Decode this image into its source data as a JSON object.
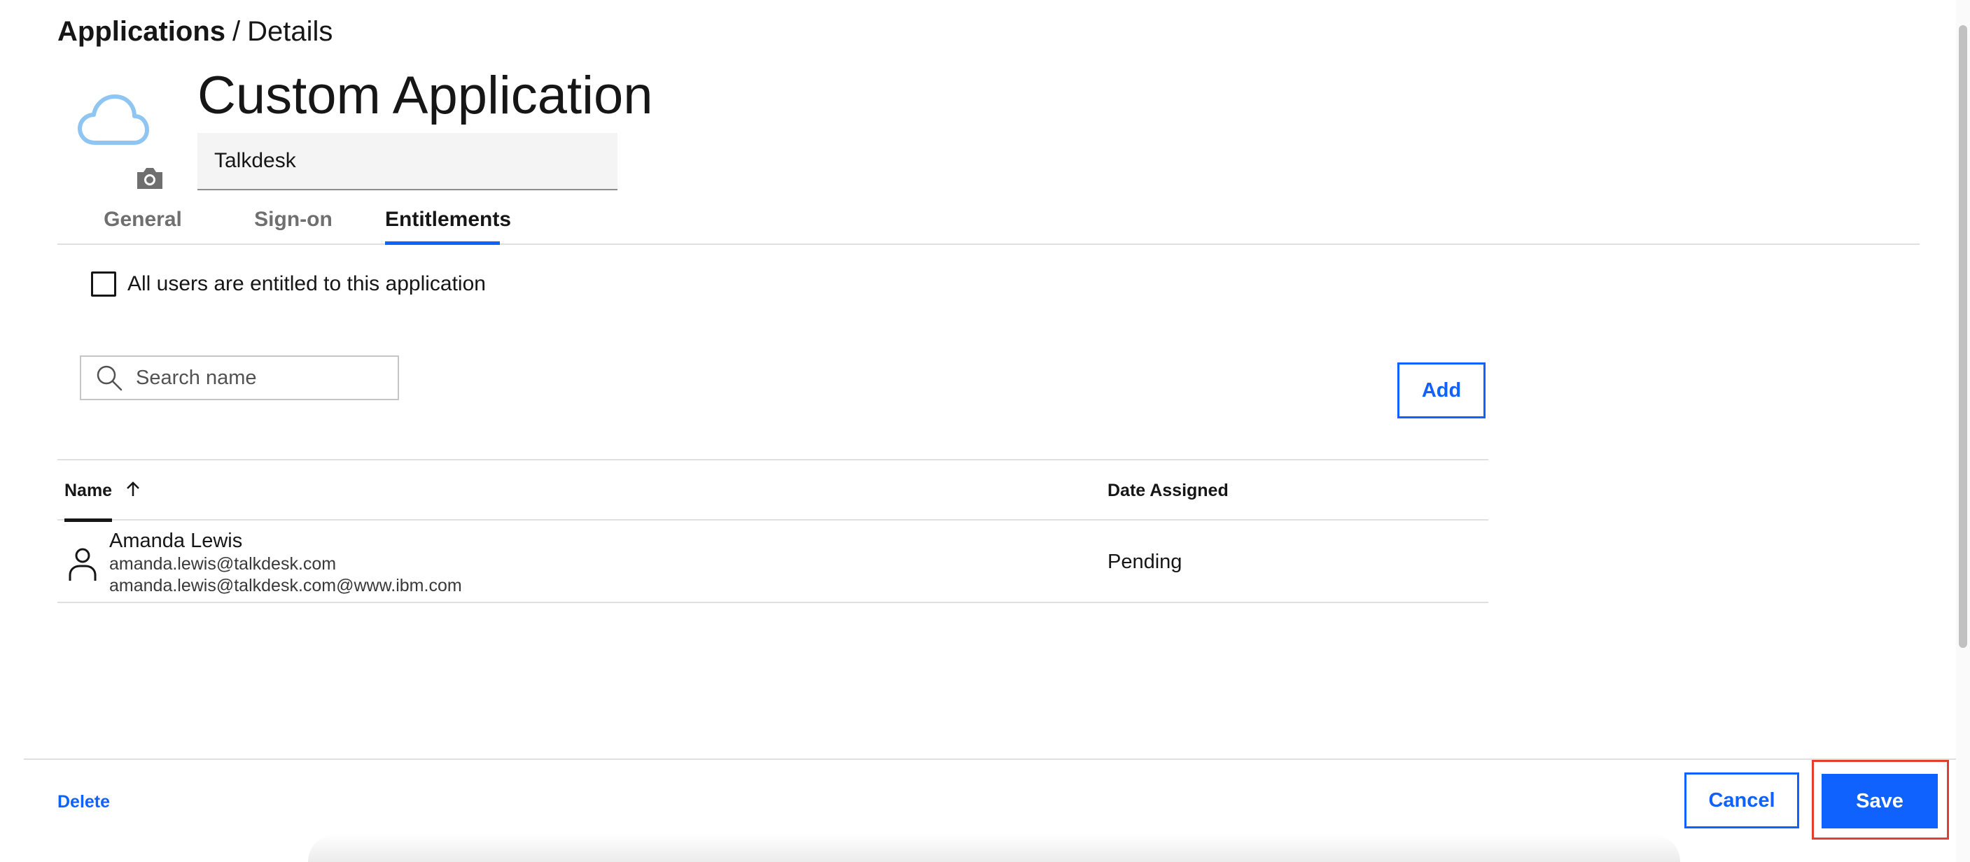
{
  "breadcrumb": {
    "root": "Applications",
    "separator": "/",
    "current": "Details"
  },
  "app": {
    "title": "Custom Application",
    "name_value": "Talkdesk",
    "icon": "cloud-icon",
    "change_icon": "camera-icon"
  },
  "tabs": [
    {
      "label": "General",
      "active": false
    },
    {
      "label": "Sign-on",
      "active": false
    },
    {
      "label": "Entitlements",
      "active": true
    }
  ],
  "entitlements": {
    "all_users_label": "All users are entitled to this application",
    "all_users_checked": false,
    "search_placeholder": "Search name",
    "add_label": "Add"
  },
  "table": {
    "columns": [
      {
        "label": "Name",
        "sort": "ascending"
      },
      {
        "label": "Date Assigned"
      }
    ],
    "rows": [
      {
        "name": "Amanda Lewis",
        "email": "amanda.lewis@talkdesk.com",
        "alias": "amanda.lewis@talkdesk.com@www.ibm.com",
        "date_assigned": "Pending",
        "icon": "user-icon"
      }
    ]
  },
  "footer": {
    "delete_label": "Delete",
    "cancel_label": "Cancel",
    "save_label": "Save"
  },
  "colors": {
    "accent": "#0f62fe",
    "highlight": "#e2402a",
    "cloud": "#8ec5f2"
  }
}
